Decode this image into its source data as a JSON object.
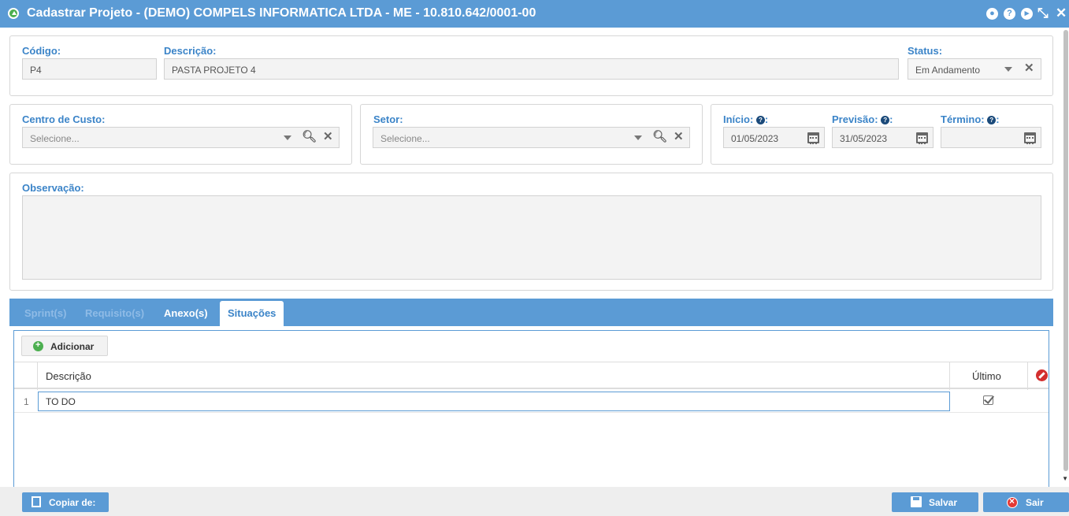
{
  "window": {
    "title": "Cadastrar Projeto - (DEMO) COMPELS INFORMATICA LTDA - ME - 10.810.642/0001-00",
    "controls": {
      "help": "?",
      "collapse": "⤡",
      "close": "✕"
    }
  },
  "form": {
    "codigo": {
      "label": "Código:",
      "value": "P4"
    },
    "descricao": {
      "label": "Descrição:",
      "value": "PASTA PROJETO 4"
    },
    "status": {
      "label": "Status:",
      "value": "Em Andamento"
    },
    "centro_custo": {
      "label": "Centro de Custo:",
      "placeholder": "Selecione..."
    },
    "setor": {
      "label": "Setor:",
      "placeholder": "Selecione..."
    },
    "inicio": {
      "label": "Início:",
      "suffix": ":",
      "value": "01/05/2023"
    },
    "previsao": {
      "label": "Previsão:",
      "suffix": ":",
      "value": "31/05/2023"
    },
    "termino": {
      "label": "Término:",
      "suffix": ":",
      "value": ""
    },
    "observacao": {
      "label": "Observação:",
      "value": ""
    }
  },
  "tabs": [
    {
      "label": "Sprint(s)",
      "state": "disabled"
    },
    {
      "label": "Requisito(s)",
      "state": "disabled"
    },
    {
      "label": "Anexo(s)",
      "state": "enabled"
    },
    {
      "label": "Situações",
      "state": "selected"
    }
  ],
  "grid": {
    "add_label": "Adicionar",
    "columns": {
      "descricao": "Descrição",
      "ultimo": "Último"
    },
    "rows": [
      {
        "num": "1",
        "descricao": "TO DO",
        "ultimo": true
      }
    ]
  },
  "footer": {
    "copy_label": "Copiar de:",
    "save_label": "Salvar",
    "exit_label": "Sair"
  },
  "colors": {
    "accent": "#5b9bd5",
    "label": "#3b84c8",
    "add_green": "#4caf50",
    "danger": "#d32f2f"
  }
}
